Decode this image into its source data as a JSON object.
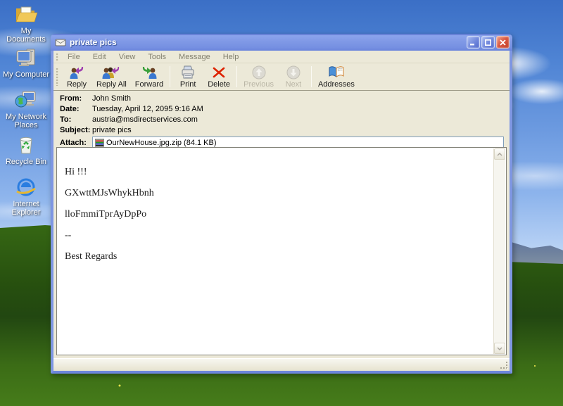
{
  "desktop": {
    "icons": [
      {
        "label": "My Documents"
      },
      {
        "label": "My Computer"
      },
      {
        "label": "My Network Places"
      },
      {
        "label": "Recycle Bin"
      },
      {
        "label": "Internet Explorer"
      }
    ]
  },
  "window": {
    "title": "private pics",
    "menu": [
      "File",
      "Edit",
      "View",
      "Tools",
      "Message",
      "Help"
    ],
    "toolbar": [
      {
        "label": "Reply",
        "enabled": true
      },
      {
        "label": "Reply All",
        "enabled": true
      },
      {
        "label": "Forward",
        "enabled": true
      },
      {
        "label": "Print",
        "enabled": true
      },
      {
        "label": "Delete",
        "enabled": true
      },
      {
        "label": "Previous",
        "enabled": false
      },
      {
        "label": "Next",
        "enabled": false
      },
      {
        "label": "Addresses",
        "enabled": true
      }
    ],
    "headers": {
      "from_label": "From:",
      "from": "John Smith",
      "date_label": "Date:",
      "date": "Tuesday, April 12, 2095 9:16 AM",
      "to_label": "To:",
      "to": "austria@msdirectservices.com",
      "subject_label": "Subject:",
      "subject": "private pics",
      "attach_label": "Attach:",
      "attachment": "OurNewHouse.jpg.zip (84.1 KB)"
    },
    "body_lines": {
      "l0": "Hi !!!",
      "l1": "GXwttMJsWhykHbnh",
      "l2": "lloFmmiTprAyDpPo",
      "l3": "--",
      "l4": "Best Regards"
    }
  },
  "colors": {
    "titlebar_blue": "#7e96e2",
    "chrome_beige": "#ece9d8",
    "delete_red": "#dd2200",
    "desktop_sky": "#6c9ae0",
    "desktop_grass": "#417c13"
  }
}
